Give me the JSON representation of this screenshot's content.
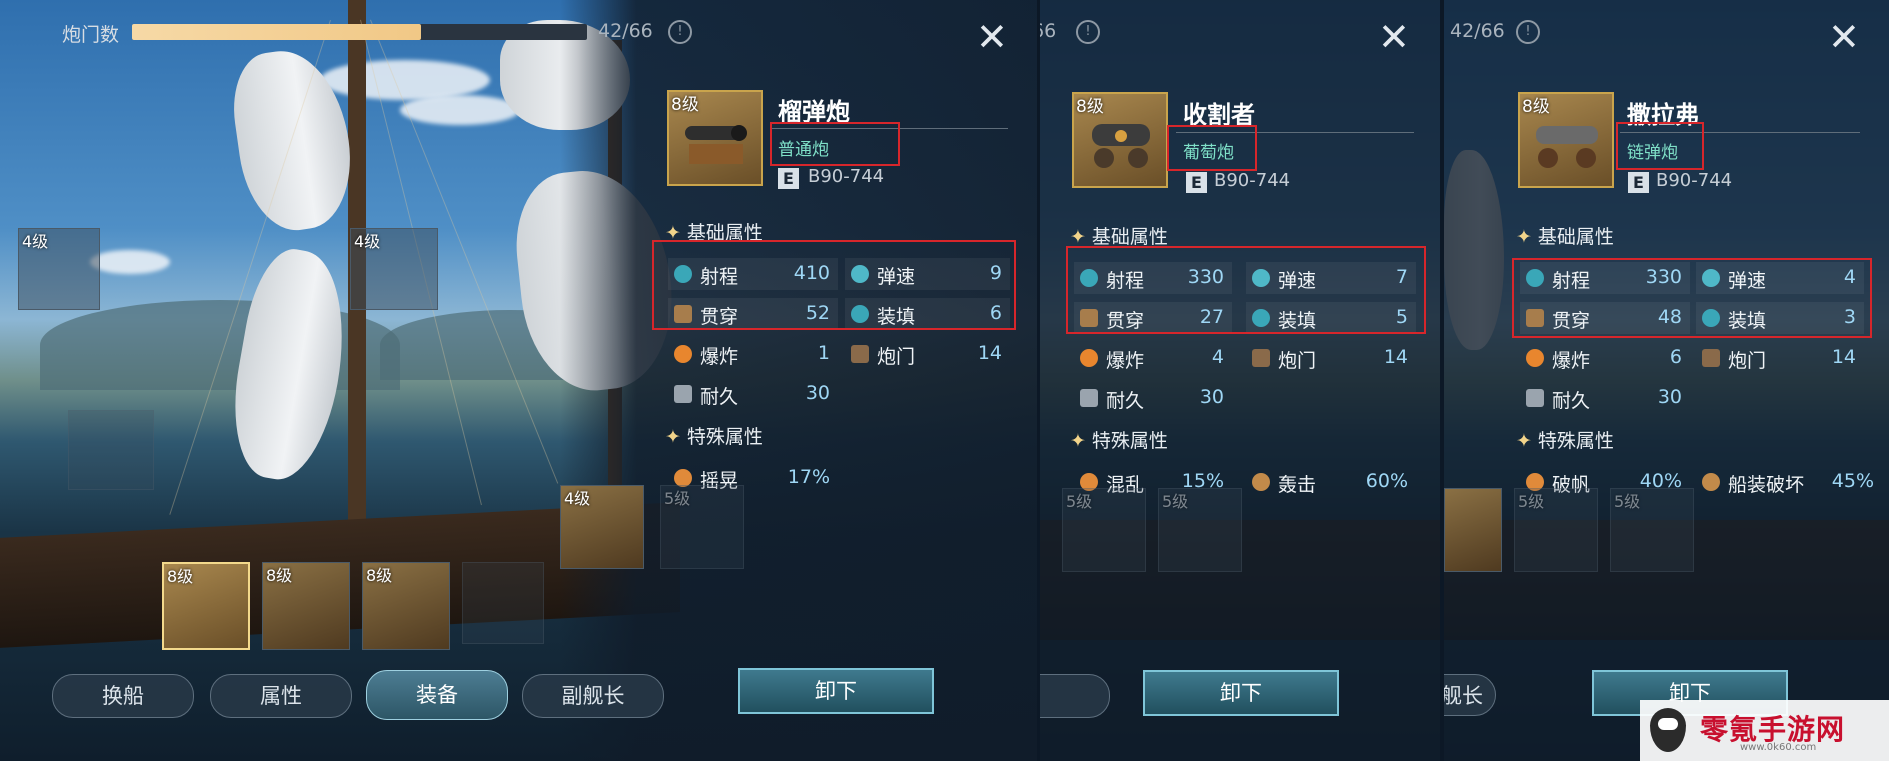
{
  "top": {
    "capacity_label": "炮门数",
    "capacity_count": "42/66",
    "capacity_fraction": 0.636,
    "info": "!"
  },
  "panels": [
    {
      "level": "8级",
      "name": "榴弹炮",
      "type": "普通炮",
      "code_badge": "E",
      "code": "B90-744",
      "basic_title": "基础属性",
      "stats": [
        {
          "name": "射程",
          "value": "410",
          "icon": "range-icon"
        },
        {
          "name": "弹速",
          "value": "9",
          "icon": "speed-icon"
        },
        {
          "name": "贯穿",
          "value": "52",
          "icon": "pierce-icon"
        },
        {
          "name": "装填",
          "value": "6",
          "icon": "reload-icon"
        },
        {
          "name": "爆炸",
          "value": "1",
          "icon": "explosion-icon"
        },
        {
          "name": "炮门",
          "value": "14",
          "icon": "gunport-icon"
        },
        {
          "name": "耐久",
          "value": "30",
          "icon": "durability-icon"
        }
      ],
      "special_title": "特殊属性",
      "special": [
        {
          "name": "摇晃",
          "value": "17%",
          "icon": "sway-icon"
        }
      ],
      "unload": "卸下"
    },
    {
      "level": "8级",
      "name": "收割者",
      "type": "葡萄炮",
      "code_badge": "E",
      "code": "B90-744",
      "basic_title": "基础属性",
      "stats": [
        {
          "name": "射程",
          "value": "330",
          "icon": "range-icon"
        },
        {
          "name": "弹速",
          "value": "7",
          "icon": "speed-icon"
        },
        {
          "name": "贯穿",
          "value": "27",
          "icon": "pierce-icon"
        },
        {
          "name": "装填",
          "value": "5",
          "icon": "reload-icon"
        },
        {
          "name": "爆炸",
          "value": "4",
          "icon": "explosion-icon"
        },
        {
          "name": "炮门",
          "value": "14",
          "icon": "gunport-icon"
        },
        {
          "name": "耐久",
          "value": "30",
          "icon": "durability-icon"
        }
      ],
      "special_title": "特殊属性",
      "special": [
        {
          "name": "混乱",
          "value": "15%",
          "icon": "chaos-icon"
        },
        {
          "name": "轰击",
          "value": "60%",
          "icon": "bombard-icon"
        }
      ],
      "unload": "卸下"
    },
    {
      "level": "8级",
      "name": "撒拉弗",
      "type": "链弹炮",
      "code_badge": "E",
      "code": "B90-744",
      "basic_title": "基础属性",
      "stats": [
        {
          "name": "射程",
          "value": "330",
          "icon": "range-icon"
        },
        {
          "name": "弹速",
          "value": "4",
          "icon": "speed-icon"
        },
        {
          "name": "贯穿",
          "value": "48",
          "icon": "pierce-icon"
        },
        {
          "name": "装填",
          "value": "3",
          "icon": "reload-icon"
        },
        {
          "name": "爆炸",
          "value": "6",
          "icon": "explosion-icon"
        },
        {
          "name": "炮门",
          "value": "14",
          "icon": "gunport-icon"
        },
        {
          "name": "耐久",
          "value": "30",
          "icon": "durability-icon"
        }
      ],
      "special_title": "特殊属性",
      "special": [
        {
          "name": "破帆",
          "value": "40%",
          "icon": "sail-break-icon"
        },
        {
          "name": "船装破坏",
          "value": "45%",
          "icon": "rigging-break-icon"
        }
      ],
      "unload": "卸下"
    }
  ],
  "slots": {
    "sail_left": "4级",
    "sail_mast": "4级",
    "armor_a": "4级",
    "armor_b": "5级",
    "cannon_1": "8级",
    "cannon_2": "8级",
    "cannon_3": "8级",
    "p2_armor_a": "5级",
    "p2_armor_b": "5级",
    "p3_armor_b": "5级",
    "p3_armor_c": "5级"
  },
  "tabs": [
    "换船",
    "属性",
    "装备",
    "副舰长"
  ],
  "tab_partial_p3": "舰长",
  "watermark": {
    "name": "零氪手游网",
    "url": "www.0k60.com"
  },
  "colors": {
    "accent_teal": "#7fe0c8",
    "stat_value": "#9fd7f5",
    "highlight_box": "#d7262b",
    "capacity_bar": "#f1c886"
  }
}
